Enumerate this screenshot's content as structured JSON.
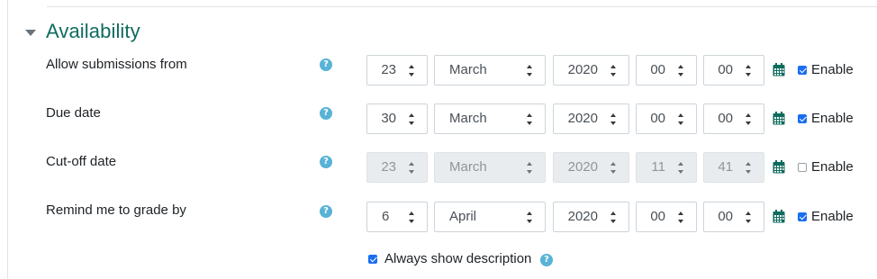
{
  "section": {
    "title": "Availability"
  },
  "help_symbol": "?",
  "icons": {
    "help": "question-circle-icon",
    "calendar": "calendar-icon",
    "collapse": "caret-down-icon"
  },
  "colors": {
    "heading": "#0f6b5d",
    "help": "#58b3d6",
    "checkbox": "#1a6ef0",
    "calendar": "#0f6b5d"
  },
  "rows": [
    {
      "label": "Allow submissions from",
      "day": "23",
      "month": "March",
      "year": "2020",
      "hour": "00",
      "minute": "00",
      "enable_label": "Enable",
      "enabled": true
    },
    {
      "label": "Due date",
      "day": "30",
      "month": "March",
      "year": "2020",
      "hour": "00",
      "minute": "00",
      "enable_label": "Enable",
      "enabled": true
    },
    {
      "label": "Cut-off date",
      "day": "23",
      "month": "March",
      "year": "2020",
      "hour": "11",
      "minute": "41",
      "enable_label": "Enable",
      "enabled": false
    },
    {
      "label": "Remind me to grade by",
      "day": "6",
      "month": "April",
      "year": "2020",
      "hour": "00",
      "minute": "00",
      "enable_label": "Enable",
      "enabled": true
    }
  ],
  "always_show_description": {
    "label": "Always show description",
    "checked": true
  }
}
